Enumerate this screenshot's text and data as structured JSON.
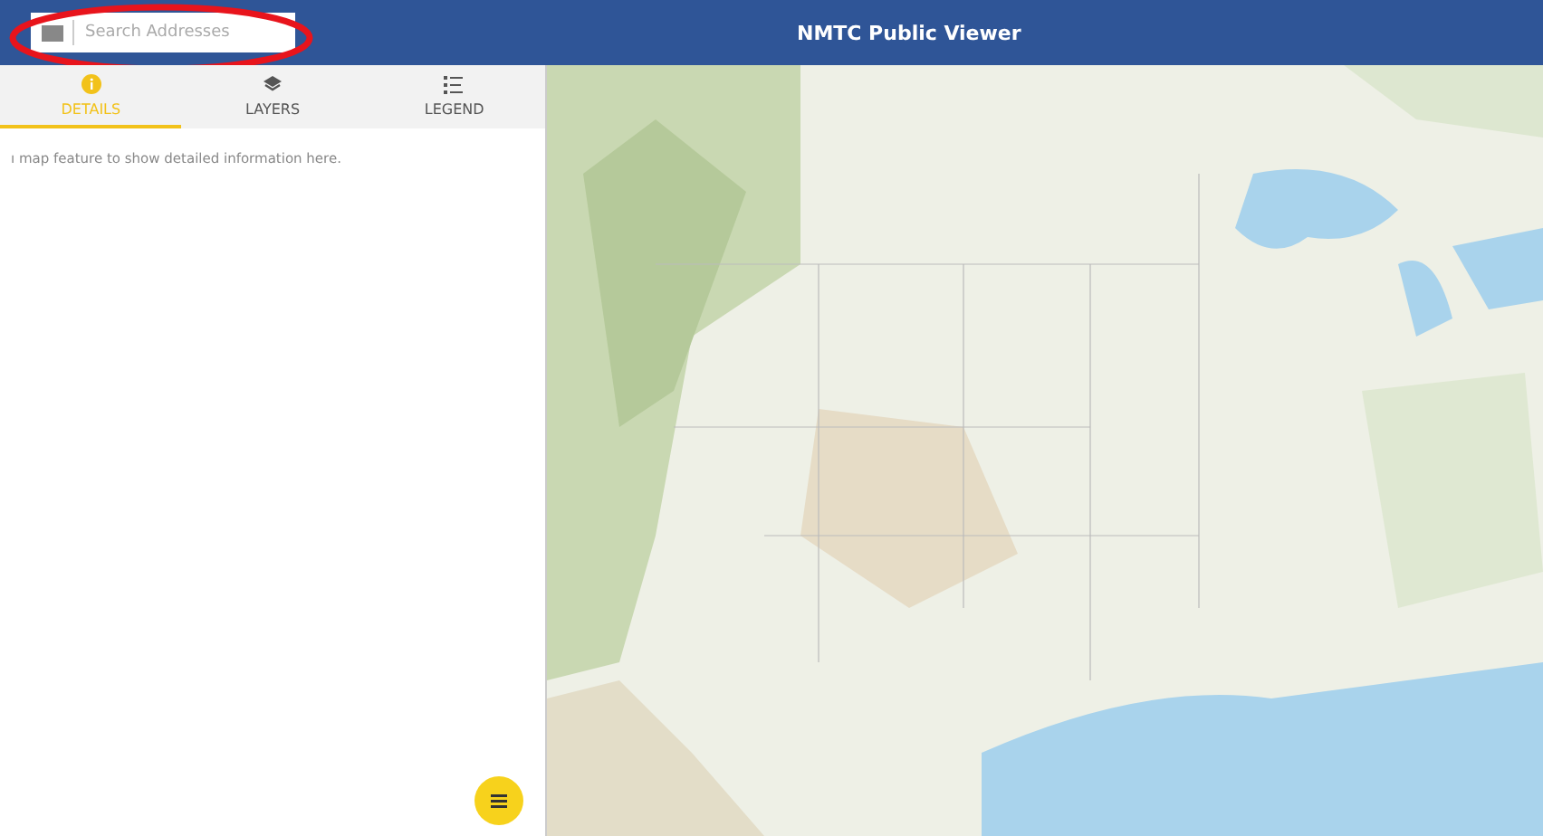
{
  "header": {
    "search": {
      "placeholder": "Search Addresses"
    },
    "title": "NMTC Public Viewer"
  },
  "tabs": [
    {
      "label": "DETAILS",
      "selected": true
    },
    {
      "label": "LAYERS",
      "selected": false
    },
    {
      "label": "LEGEND",
      "selected": false
    }
  ],
  "details": {
    "message": "ı map feature to show detailed information here."
  }
}
